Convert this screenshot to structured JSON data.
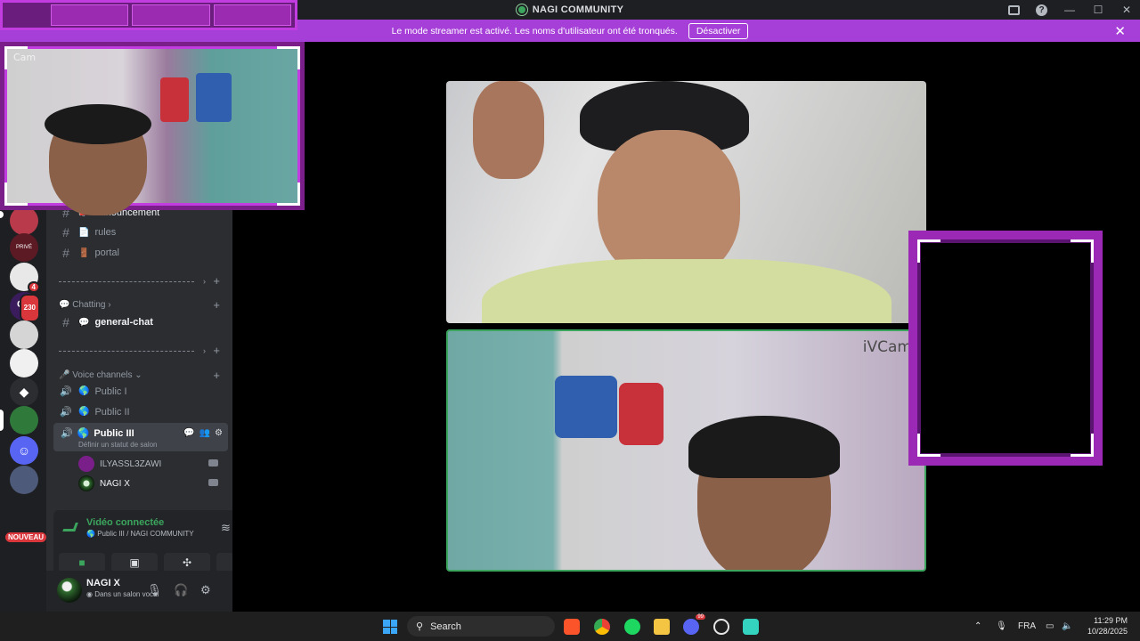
{
  "window": {
    "title": "NAGI COMMUNITY"
  },
  "banner": {
    "message": "Le mode streamer est activé. Les noms d'utilisateur ont été tronqués.",
    "button": "Désactiver"
  },
  "servers": [
    {
      "name": "server-1",
      "color": "#b83a4b"
    },
    {
      "name": "server-2",
      "color": "#5c1a24",
      "text": "PRIVÉ"
    },
    {
      "name": "server-3",
      "color": "#e8e8e8",
      "badge": "4"
    },
    {
      "name": "server-4",
      "color": "#3a1c5c",
      "text": "OP",
      "badge": "230"
    },
    {
      "name": "server-5",
      "color": "#d5d5d5"
    },
    {
      "name": "server-6",
      "color": "#f0f0f0"
    },
    {
      "name": "server-7",
      "color": "#2b2d31"
    },
    {
      "name": "server-8",
      "color": "#2f7a3a"
    },
    {
      "name": "server-9",
      "color": "#5865f2"
    },
    {
      "name": "server-10",
      "color": "#4d5a7a"
    }
  ],
  "new_badge": "NOUVEAU",
  "channels": {
    "text": [
      {
        "label": "announcement",
        "emoji": "📣"
      },
      {
        "label": "rules",
        "emoji": "📄"
      },
      {
        "label": "portal",
        "emoji": "🚪"
      }
    ],
    "chatting_category": "Chatting",
    "chatting_emoji": "💬",
    "general": {
      "label": "general-chat",
      "emoji": "💬"
    },
    "voice_category": "Voice channels",
    "voice_emoji": "🎤",
    "voice": [
      {
        "label": "Public I"
      },
      {
        "label": "Public II"
      },
      {
        "label": "Public III",
        "status": "Définir un statut de salon"
      }
    ],
    "members": [
      {
        "name": "ILYASSL3ZAWI"
      },
      {
        "name": "NAGI X"
      }
    ]
  },
  "voice_panel": {
    "status": "Vidéo connectée",
    "location": "Public III / NAGI COMMUNITY"
  },
  "user": {
    "name": "NAGI X",
    "status": "Dans un salon vocal"
  },
  "streams": {
    "pip_label": "Cam",
    "bottom_label": "iVCam"
  },
  "taskbar": {
    "search": "Search",
    "language": "FRA",
    "time": "11:29 PM",
    "date": "10/28/2025",
    "discord_badge": "99"
  },
  "colors": {
    "accent_purple": "#a63ed8",
    "frame_purple": "#9b29b5",
    "online_green": "#3ba55d",
    "danger_red": "#da373c"
  }
}
